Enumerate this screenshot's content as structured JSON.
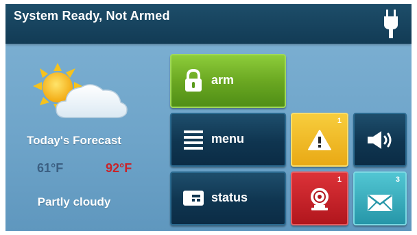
{
  "status_bar": {
    "status_text": "System Ready, Not Armed",
    "power_icon": "power-plug-icon"
  },
  "weather": {
    "icon": "partly-cloudy-icon",
    "title": "Today's Forecast",
    "low": "61°F",
    "high": "92°F",
    "condition": "Partly cloudy"
  },
  "buttons": {
    "arm": {
      "label": "arm",
      "icon": "lock-icon"
    },
    "menu": {
      "label": "menu",
      "icon": "menu-list-icon"
    },
    "status": {
      "label": "status",
      "icon": "status-panel-icon"
    }
  },
  "tiles": {
    "alerts": {
      "icon": "warning-icon",
      "count": "1"
    },
    "volume": {
      "icon": "speaker-icon"
    },
    "troubles": {
      "icon": "bell-icon",
      "count": "1"
    },
    "messages": {
      "icon": "envelope-icon",
      "count": "3"
    }
  },
  "colors": {
    "arm_green": "#6ba822",
    "alert_yellow": "#e9a915",
    "trouble_red": "#b1161d",
    "message_teal": "#2696a8",
    "status_bar": "#123b55",
    "background": "#6ea4c9"
  }
}
